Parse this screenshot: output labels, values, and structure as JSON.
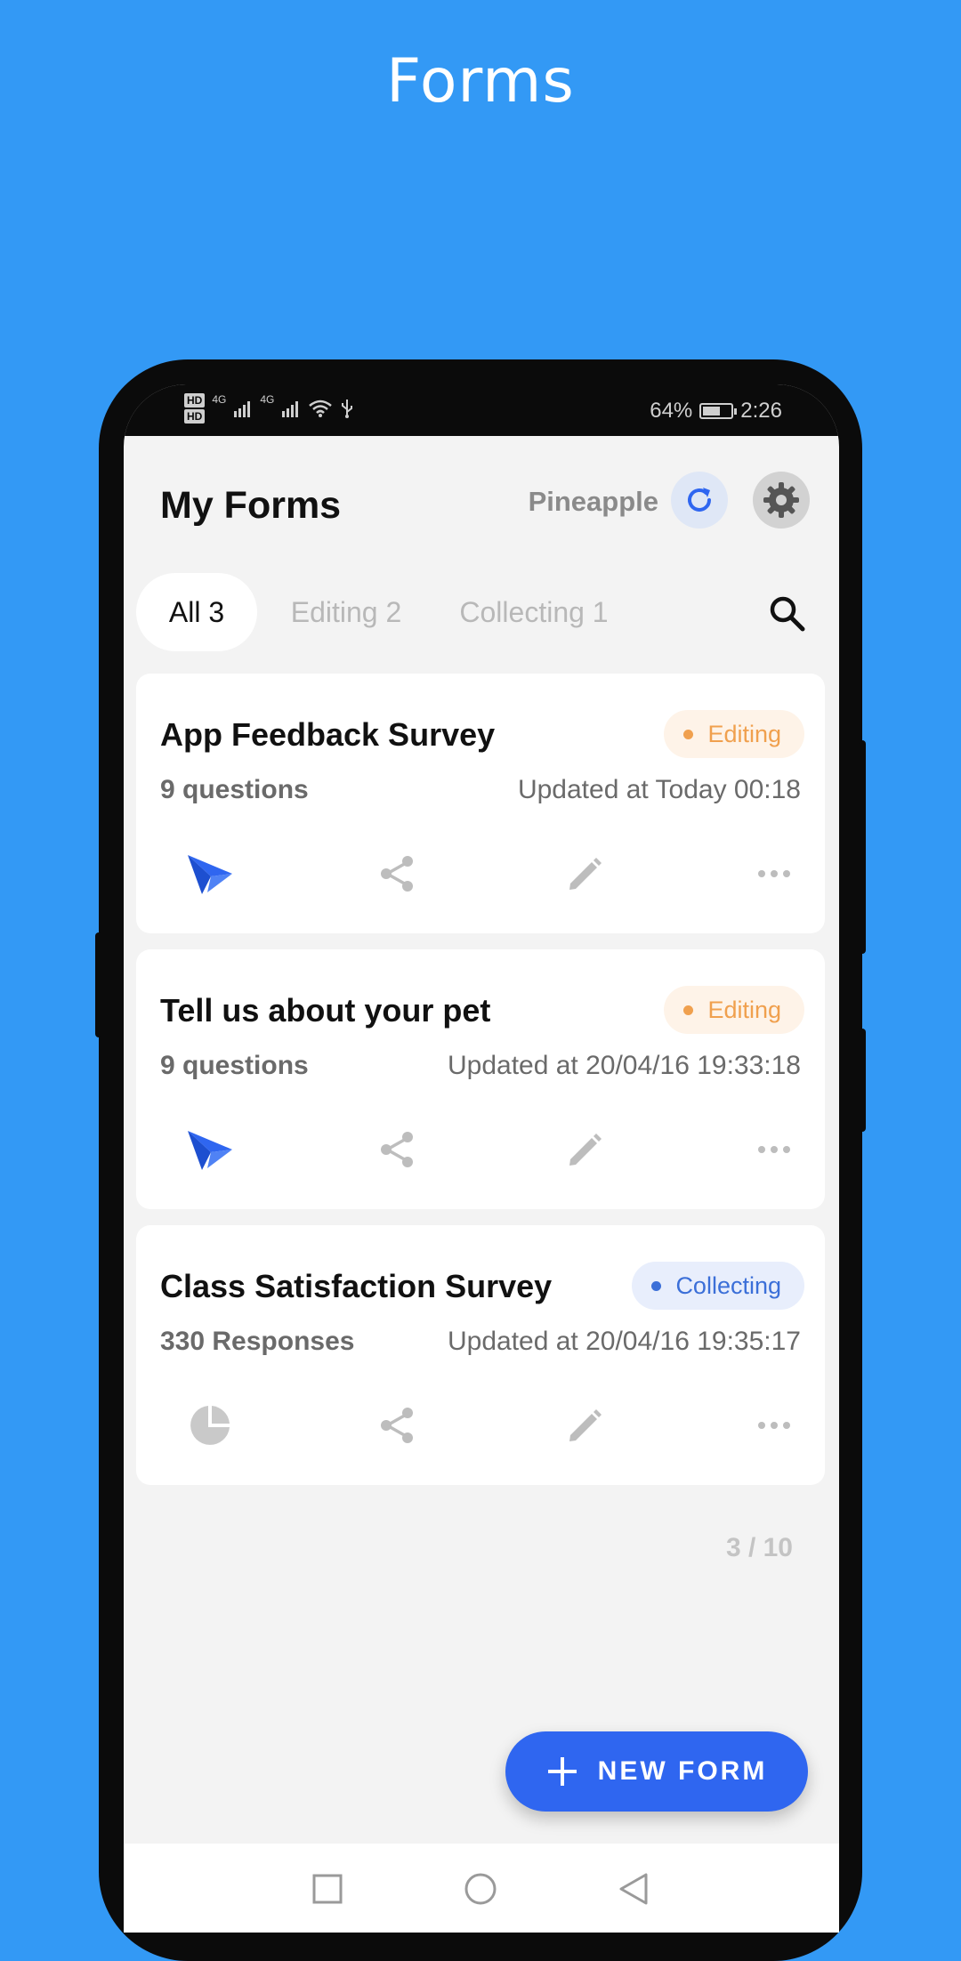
{
  "page": {
    "title": "Forms"
  },
  "statusbar": {
    "hd1": "HD",
    "hd2": "HD",
    "net1": "4G",
    "net2": "4G",
    "battery_percent_text": "64%",
    "battery_level": 0.64,
    "time": "2:26"
  },
  "header": {
    "title": "My Forms",
    "user": "Pineapple"
  },
  "tabs": [
    {
      "label": "All 3",
      "active": true
    },
    {
      "label": "Editing 2",
      "active": false
    },
    {
      "label": "Collecting 1",
      "active": false
    }
  ],
  "forms": [
    {
      "title": "App Feedback Survey",
      "status": "Editing",
      "count": "9 questions",
      "updated": "Updated at Today 00:18",
      "primary_icon": "send-icon"
    },
    {
      "title": "Tell us about your pet",
      "status": "Editing",
      "count": "9 questions",
      "updated": "Updated at 20/04/16 19:33:18",
      "primary_icon": "send-icon"
    },
    {
      "title": "Class Satisfaction Survey",
      "status": "Collecting",
      "count": "330 Responses",
      "updated": "Updated at 20/04/16 19:35:17",
      "primary_icon": "pie-chart-icon"
    }
  ],
  "pager": "3 / 10",
  "fab": {
    "label": "NEW FORM"
  },
  "colors": {
    "background": "#3399f5",
    "accent": "#2f66f0",
    "editing": "#f0a04e",
    "collecting": "#3b6fd8"
  }
}
